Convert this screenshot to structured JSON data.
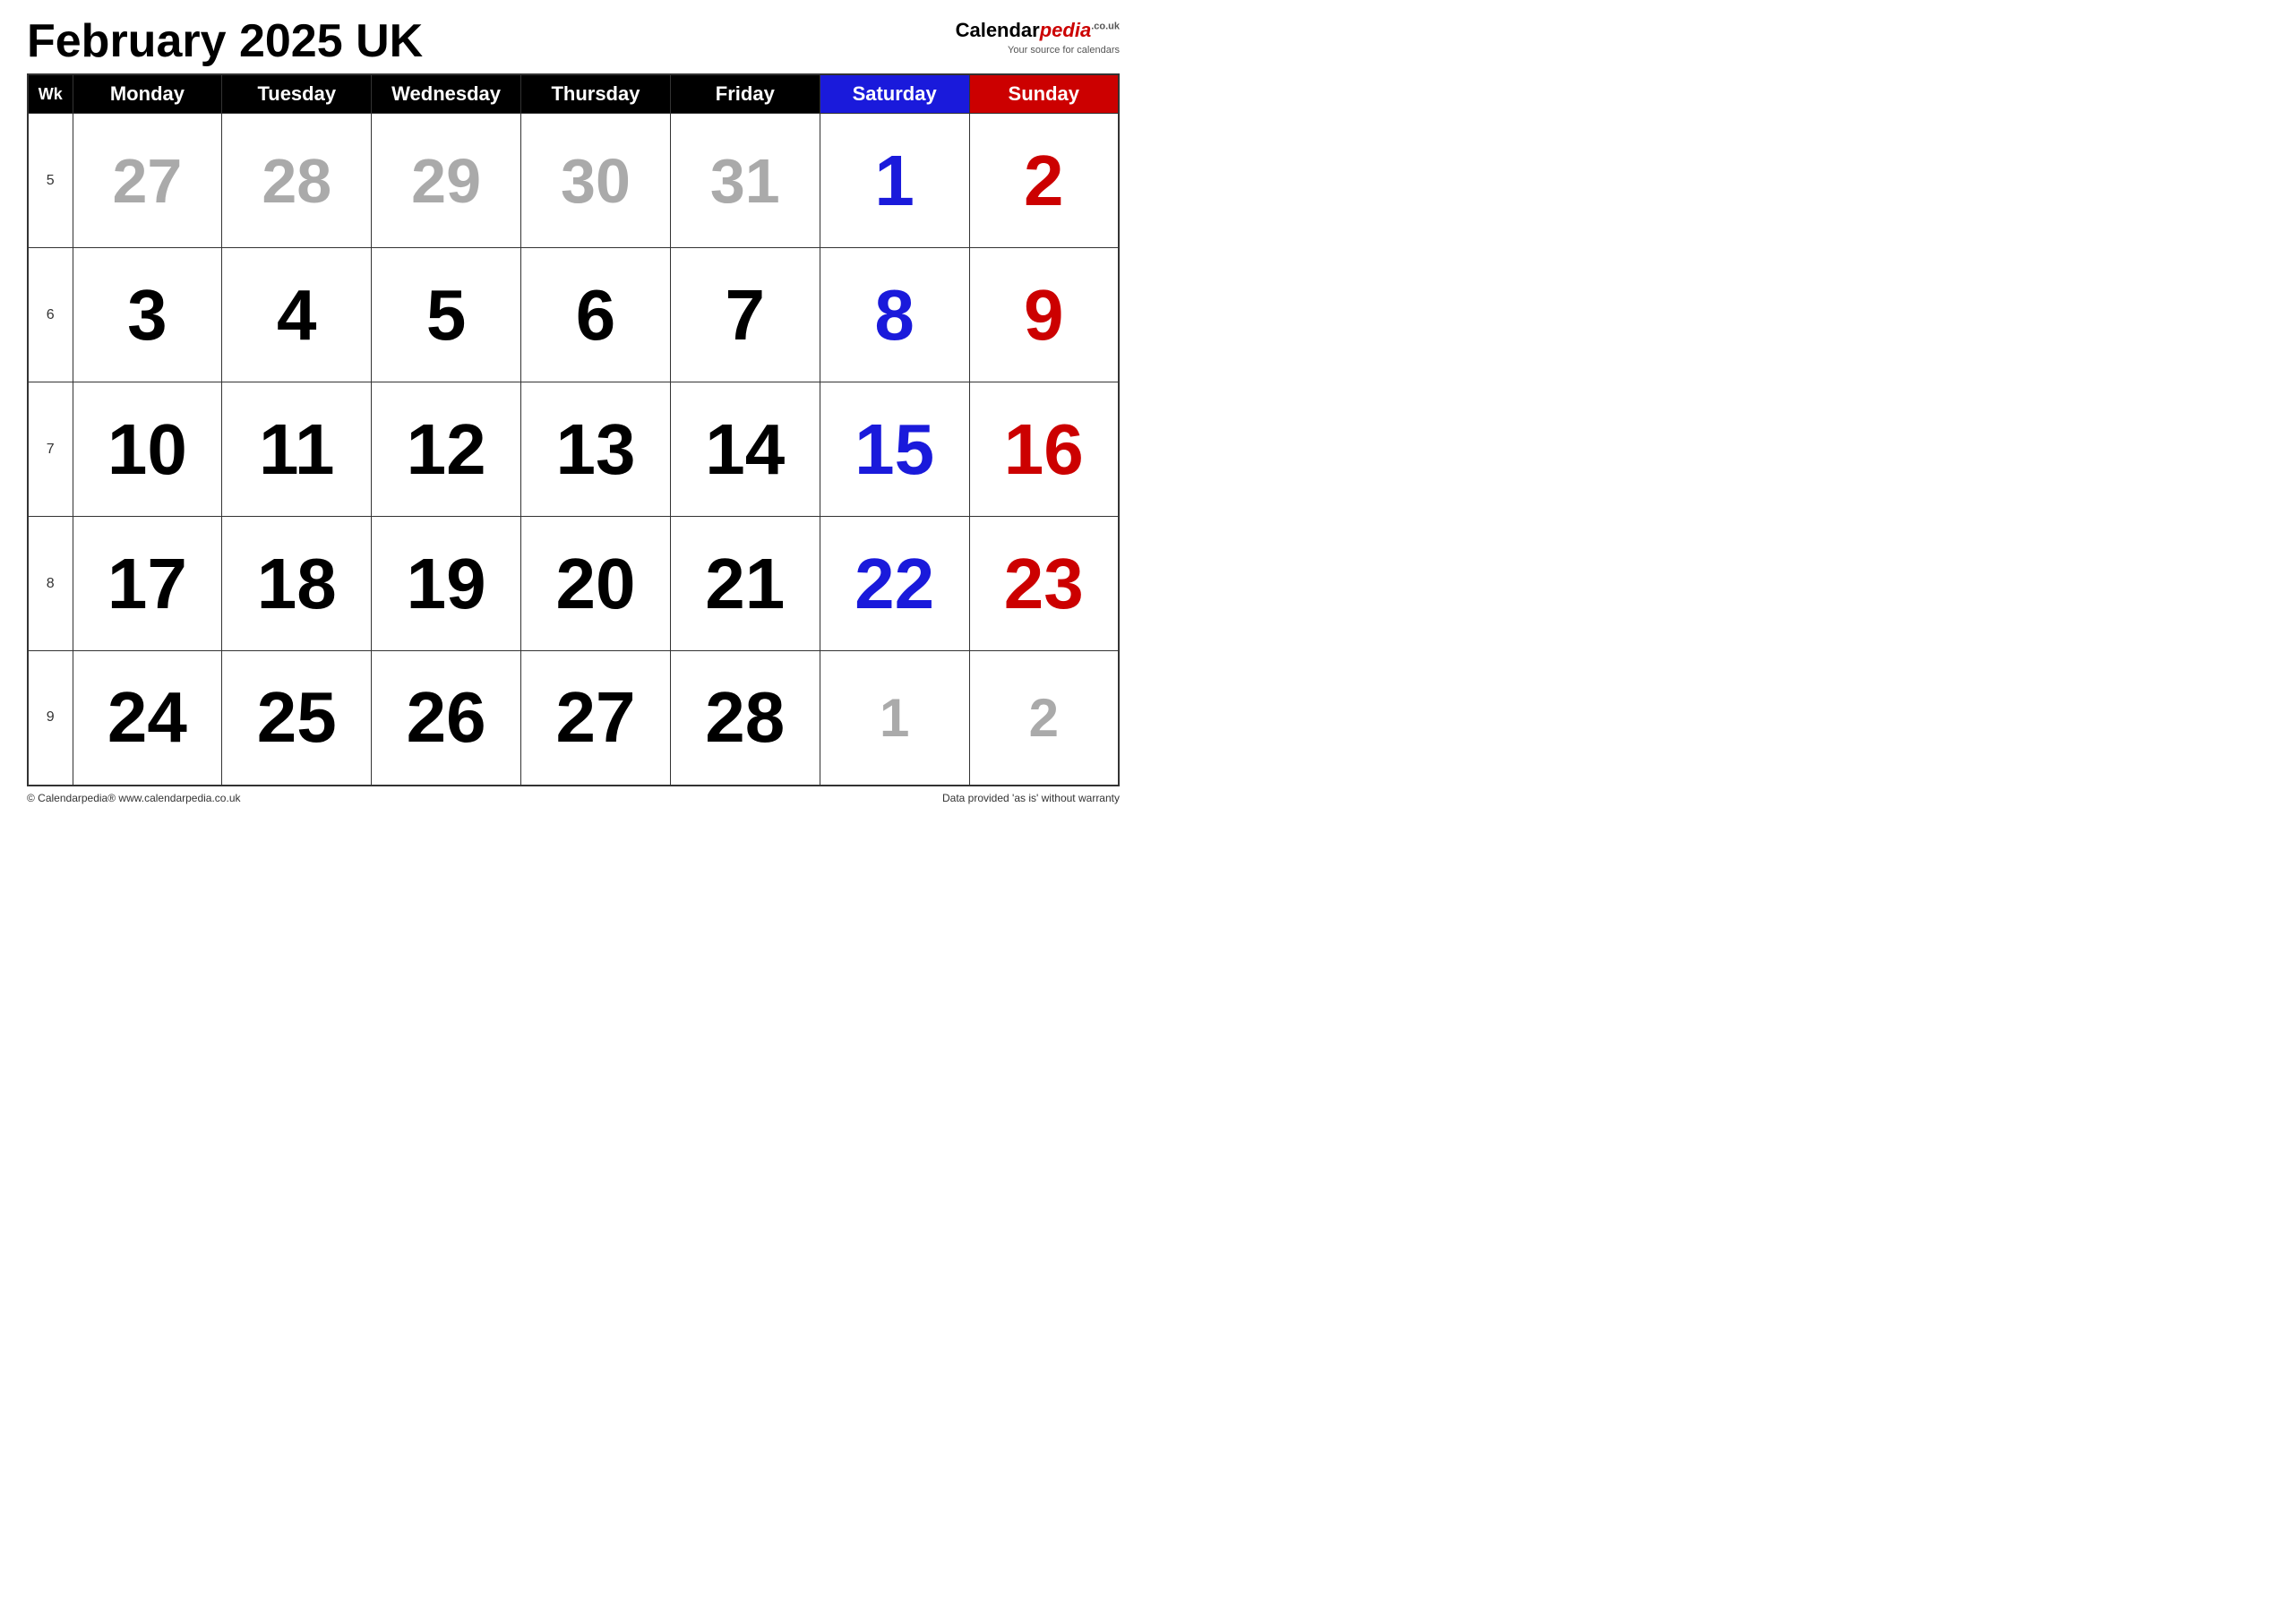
{
  "title": "February 2025 UK",
  "logo": {
    "brand": "Calendar",
    "brand_italic": "pedia",
    "co_uk": ".co.uk",
    "tagline": "Your source for calendars"
  },
  "header": {
    "wk_label": "Wk",
    "days": [
      "Monday",
      "Tuesday",
      "Wednesday",
      "Thursday",
      "Friday",
      "Saturday",
      "Sunday"
    ]
  },
  "weeks": [
    {
      "week_num": "5",
      "days": [
        {
          "num": "27",
          "type": "prev"
        },
        {
          "num": "28",
          "type": "prev"
        },
        {
          "num": "29",
          "type": "prev"
        },
        {
          "num": "30",
          "type": "prev"
        },
        {
          "num": "31",
          "type": "prev"
        },
        {
          "num": "1",
          "type": "saturday"
        },
        {
          "num": "2",
          "type": "sunday"
        }
      ]
    },
    {
      "week_num": "6",
      "days": [
        {
          "num": "3",
          "type": "current"
        },
        {
          "num": "4",
          "type": "current"
        },
        {
          "num": "5",
          "type": "current"
        },
        {
          "num": "6",
          "type": "current"
        },
        {
          "num": "7",
          "type": "current"
        },
        {
          "num": "8",
          "type": "saturday"
        },
        {
          "num": "9",
          "type": "sunday"
        }
      ]
    },
    {
      "week_num": "7",
      "days": [
        {
          "num": "10",
          "type": "current"
        },
        {
          "num": "11",
          "type": "current"
        },
        {
          "num": "12",
          "type": "current"
        },
        {
          "num": "13",
          "type": "current"
        },
        {
          "num": "14",
          "type": "current"
        },
        {
          "num": "15",
          "type": "saturday"
        },
        {
          "num": "16",
          "type": "sunday"
        }
      ]
    },
    {
      "week_num": "8",
      "days": [
        {
          "num": "17",
          "type": "current"
        },
        {
          "num": "18",
          "type": "current"
        },
        {
          "num": "19",
          "type": "current"
        },
        {
          "num": "20",
          "type": "current"
        },
        {
          "num": "21",
          "type": "current"
        },
        {
          "num": "22",
          "type": "saturday"
        },
        {
          "num": "23",
          "type": "sunday"
        }
      ]
    },
    {
      "week_num": "9",
      "days": [
        {
          "num": "24",
          "type": "current"
        },
        {
          "num": "25",
          "type": "current"
        },
        {
          "num": "26",
          "type": "current"
        },
        {
          "num": "27",
          "type": "current"
        },
        {
          "num": "28",
          "type": "current"
        },
        {
          "num": "1",
          "type": "next"
        },
        {
          "num": "2",
          "type": "next"
        }
      ]
    }
  ],
  "footer": {
    "left": "© Calendarpedia®  www.calendarpedia.co.uk",
    "right": "Data provided 'as is' without warranty"
  }
}
